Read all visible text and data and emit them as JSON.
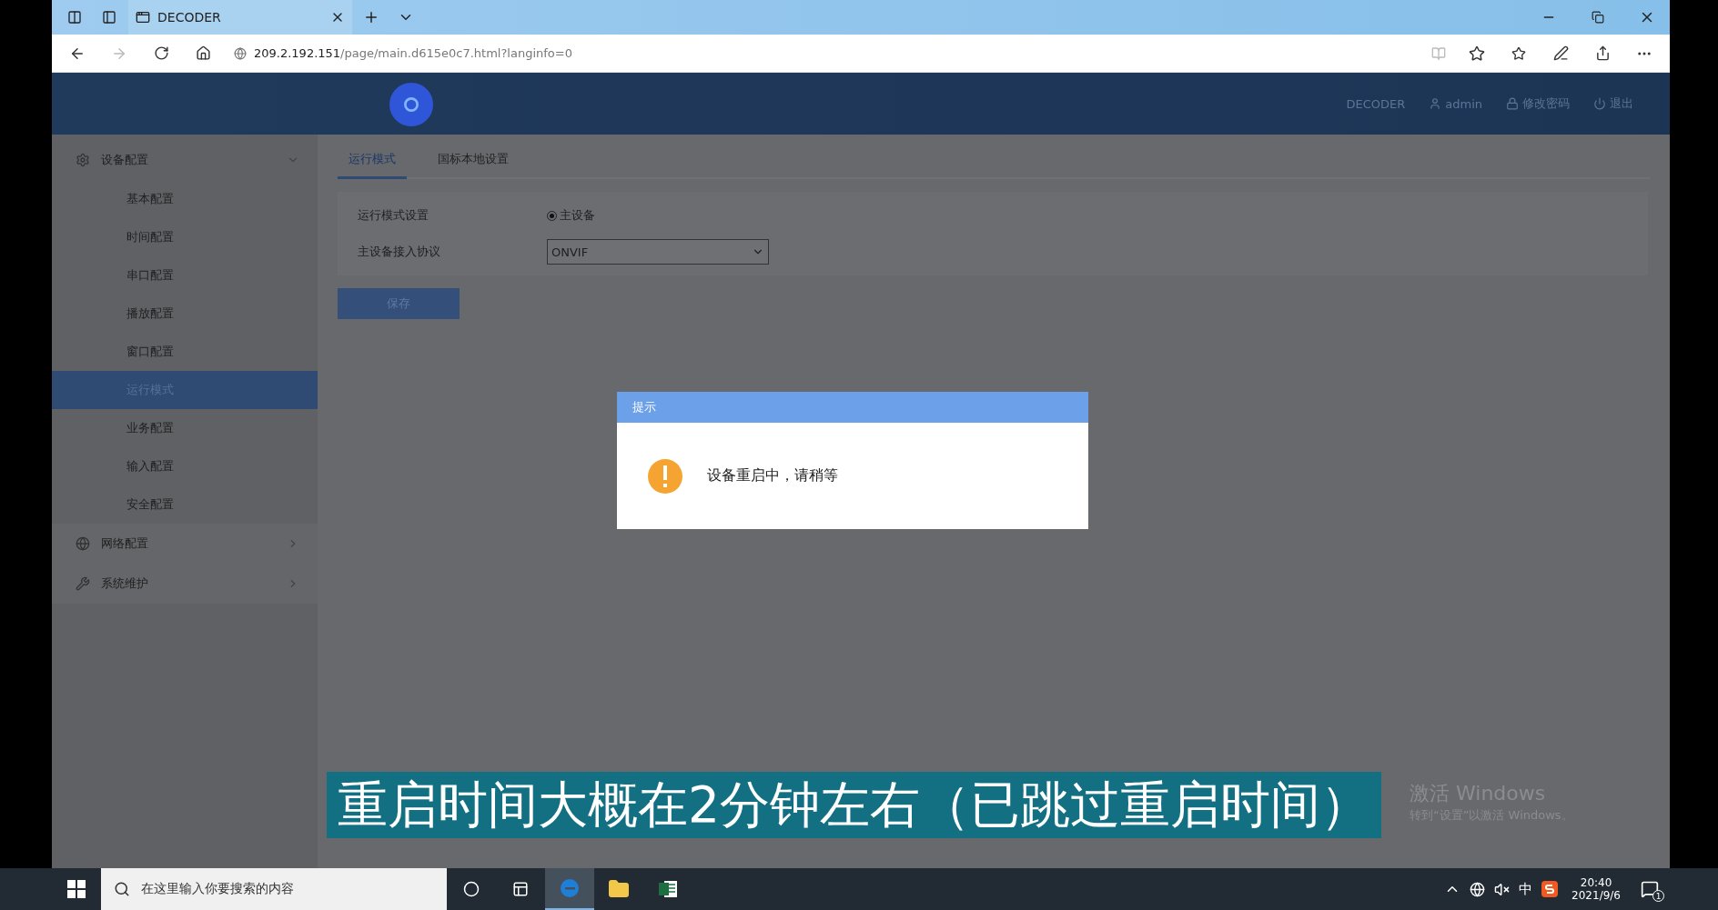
{
  "browser": {
    "tabs": [
      {
        "title": "DECODER",
        "selected": true
      }
    ],
    "url_host": "209.2.192.151",
    "url_path": "/page/main.d615e0c7.html?langinfo=0"
  },
  "header": {
    "brand": "DECODER",
    "user": "admin",
    "change_password": "修改密码",
    "logout": "退出"
  },
  "sidebar": {
    "groups": [
      {
        "label": "设备配置",
        "expanded": true,
        "children": [
          {
            "label": "基本配置",
            "selected": false
          },
          {
            "label": "时间配置",
            "selected": false
          },
          {
            "label": "串口配置",
            "selected": false
          },
          {
            "label": "播放配置",
            "selected": false
          },
          {
            "label": "窗口配置",
            "selected": false
          },
          {
            "label": "运行模式",
            "selected": true
          },
          {
            "label": "业务配置",
            "selected": false
          },
          {
            "label": "输入配置",
            "selected": false
          },
          {
            "label": "安全配置",
            "selected": false
          }
        ]
      },
      {
        "label": "网络配置",
        "expanded": false
      },
      {
        "label": "系统维护",
        "expanded": false
      }
    ]
  },
  "tabs": [
    {
      "label": "运行模式",
      "selected": true
    },
    {
      "label": "国标本地设置",
      "selected": false
    }
  ],
  "form": {
    "rows": [
      {
        "kind": "radio",
        "label": "运行模式设置",
        "options": [
          {
            "label": "主设备",
            "selected": true
          }
        ]
      },
      {
        "kind": "select",
        "label": "主设备接入协议",
        "value": "ONVIF"
      }
    ],
    "save_button": "保存"
  },
  "dialog": {
    "title": "提示",
    "message": "设备重启中，请稍等"
  },
  "caption": "重启时间大概在2分钟左右（已跳过重启时间）",
  "os_notice": {
    "title": "激活 Windows",
    "text": "转到“设置”以激活 Windows。"
  },
  "taskbar": {
    "search_placeholder": "在这里输入你要搜索的内容",
    "apps": [
      {
        "kind": "edge",
        "selected": true
      },
      {
        "kind": "explorer",
        "selected": false
      },
      {
        "kind": "excel",
        "selected": false
      }
    ],
    "ime": "中",
    "time": "20:40",
    "date": "2021/9/6",
    "notifications": "1"
  }
}
